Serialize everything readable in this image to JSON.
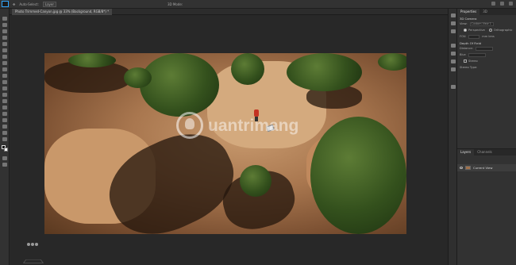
{
  "app": {
    "logo": "Ps",
    "accent": "#31a8ff"
  },
  "options_bar": {
    "auto_select_label": "Auto-Select:",
    "auto_select_value": "Layer",
    "mode_label": "3D Mode:"
  },
  "document": {
    "tab_title": "Photo Trimmed-Canyon.jpg @ 33% (Background, RGB/8*) *"
  },
  "watermark": {
    "text": "uantrimang"
  },
  "properties": {
    "tab_properties": "Properties",
    "tab_3d": "3D",
    "section": "3D Camera",
    "view_label": "View:",
    "view_value": "Custom View 1",
    "perspective_label": "Perspective",
    "orthographic_label": "Orthographic",
    "fov_label": "FOV:",
    "fov_unit": "mm lens",
    "dof_section": "Depth Of Field",
    "distance_label": "Distance:",
    "blur_label": "Blur:",
    "stereo_label": "Stereo",
    "stereo_type_label": "Stereo Type:"
  },
  "layers": {
    "tab_layers": "Layers",
    "tab_channels": "Channels",
    "current_layer": "Current View"
  }
}
